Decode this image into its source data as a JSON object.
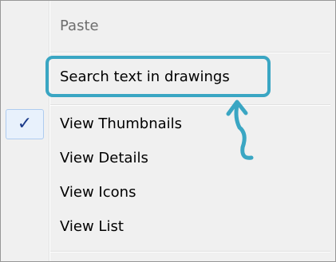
{
  "menu": {
    "items": [
      {
        "label": "Paste",
        "disabled": true
      },
      {
        "label": "Search text in drawings",
        "disabled": false
      },
      {
        "label": "View Thumbnails",
        "disabled": false,
        "checked": true
      },
      {
        "label": "View Details",
        "disabled": false
      },
      {
        "label": "View Icons",
        "disabled": false
      },
      {
        "label": "View List",
        "disabled": false
      }
    ],
    "check_glyph": "✓"
  },
  "colors": {
    "highlight": "#3aa6c3",
    "check_bg": "#e8f1fc",
    "check_border": "#aeccf0",
    "check_mark": "#1a3a8a",
    "disabled_text": "#6d6d6d"
  },
  "icons": {
    "check": "checkmark-icon",
    "annotation_arrow": "curved-up-arrow-icon"
  }
}
